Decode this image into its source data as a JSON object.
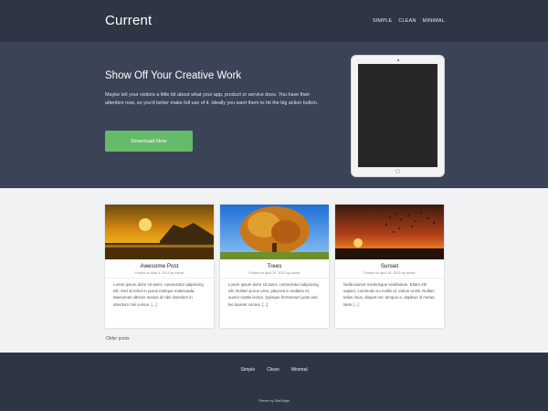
{
  "header": {
    "logo": "Current",
    "nav": [
      "SIMPLE",
      "CLEAN",
      "MINIMAL"
    ]
  },
  "hero": {
    "title": "Show Off Your Creative Work",
    "text": "Maybe tell your visitors a little bit about what your app, product or service does. You have their attention now, so you'd better make full use of it. Ideally you want them to hit the big action button.",
    "button": "Download Now"
  },
  "posts": [
    {
      "title": "Awesome Post",
      "meta": "Posted on May 6, 2013 by admin",
      "excerpt": "Lorem ipsum dolor sit amet, consectetur adipiscing elit. Sed at tortor in purus tristique malesuada. Maecenas ultrices massa id nibh interdum in interdum nisi cursus. [...]",
      "image": "sunset-beach-photo"
    },
    {
      "title": "Trees",
      "meta": "Posted on April 30, 2013 by admin",
      "excerpt": "Lorem ipsum dolor sit amet, consectetur adipiscing elit. Nullam purus urna, placerat in sodales et, auctor mattis lectus. Quisque fermentum justo sed leo laoreet cursus. [...]",
      "image": "autumn-tree-photo"
    },
    {
      "title": "Sunset",
      "meta": "Posted on April 30, 2013 by admin",
      "excerpt": "Nulla laoreet scelerisque vestibulum. Etiam elit sapien, commodo eu mollis id, varius ut elit. Nullam tellus risus, aliquet nec tempus a, dapibus id metus. Nam [...]",
      "image": "sunset-birds-photo"
    }
  ],
  "older_posts": "Older posts",
  "footer": {
    "nav": [
      "Simple",
      "Clean",
      "Minimal"
    ],
    "credit": "Theme by SiteOrigin"
  },
  "colors": {
    "header_bg": "#2e3646",
    "hero_bg": "#3b4457",
    "accent": "#66bb6a",
    "body_bg": "#f1f2f4"
  }
}
